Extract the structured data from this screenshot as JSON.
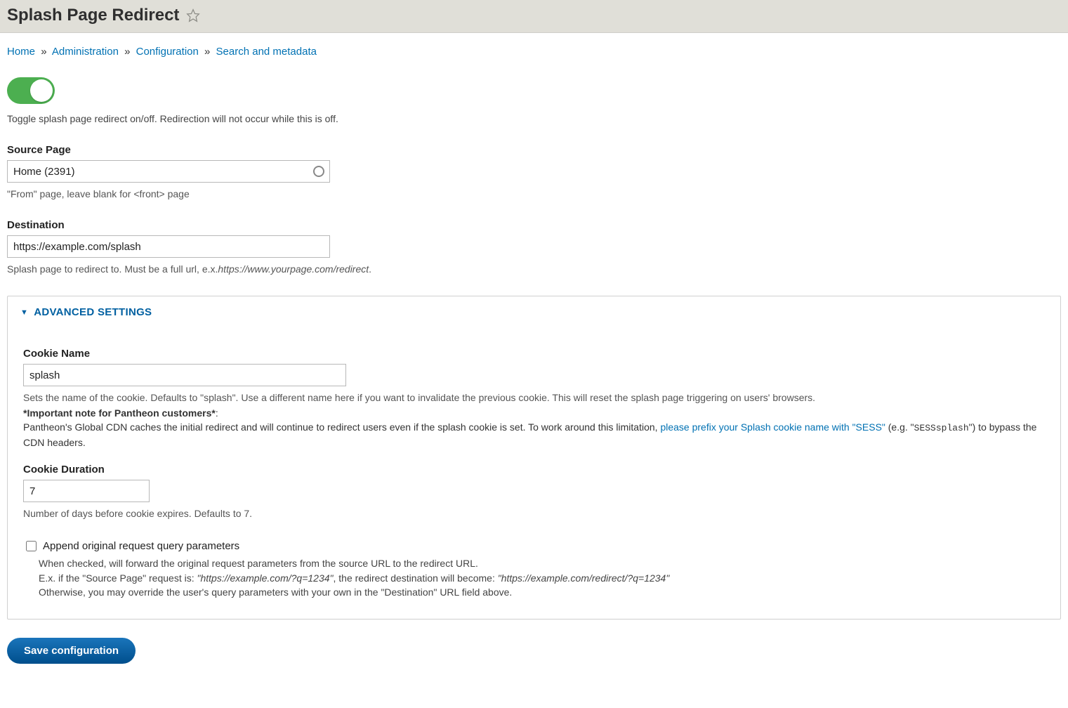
{
  "header": {
    "title": "Splash Page Redirect"
  },
  "breadcrumb": {
    "items": [
      "Home",
      "Administration",
      "Configuration",
      "Search and metadata"
    ],
    "separator": "»"
  },
  "toggle": {
    "enabled": true,
    "description": "Toggle splash page redirect on/off. Redirection will not occur while this is off."
  },
  "source_page": {
    "label": "Source Page",
    "value": "Home (2391)",
    "helper": "\"From\" page, leave blank for <front> page"
  },
  "destination": {
    "label": "Destination",
    "value": "https://example.com/splash",
    "helper_prefix": "Splash page to redirect to. Must be a full url, e.x.",
    "helper_example": "https://www.yourpage.com/redirect",
    "helper_suffix": "."
  },
  "advanced": {
    "title": "ADVANCED SETTINGS",
    "cookie_name": {
      "label": "Cookie Name",
      "value": "splash",
      "helper": "Sets the name of the cookie. Defaults to \"splash\". Use a different name here if you want to invalidate the previous cookie. This will reset the splash page triggering on users' browsers."
    },
    "pantheon": {
      "note_label": "*Important note for Pantheon customers*",
      "note_colon": ":",
      "line_pre": "Pantheon's Global CDN caches the initial redirect and will continue to redirect users even if the splash cookie is set. To work around this limitation, ",
      "link": "please prefix your Splash cookie name with \"SESS\"",
      "line_post_pre": " (e.g. \"",
      "code": "SESSsplash",
      "line_post_post": "\") to bypass the CDN headers."
    },
    "cookie_duration": {
      "label": "Cookie Duration",
      "value": "7",
      "helper": "Number of days before cookie expires. Defaults to 7."
    },
    "append_query": {
      "label": "Append original request query parameters",
      "checked": false,
      "desc_line1": "When checked, will forward the original request parameters from the source URL to the redirect URL.",
      "desc_line2_pre": "E.x. if the \"Source Page\" request is: ",
      "desc_line2_it1": "\"https://example.com/?q=1234\"",
      "desc_line2_mid": ", the redirect destination will become: ",
      "desc_line2_it2": "\"https://example.com/redirect/?q=1234\"",
      "desc_line3": "Otherwise, you may override the user's query parameters with your own in the \"Destination\" URL field above."
    }
  },
  "actions": {
    "save": "Save configuration"
  }
}
